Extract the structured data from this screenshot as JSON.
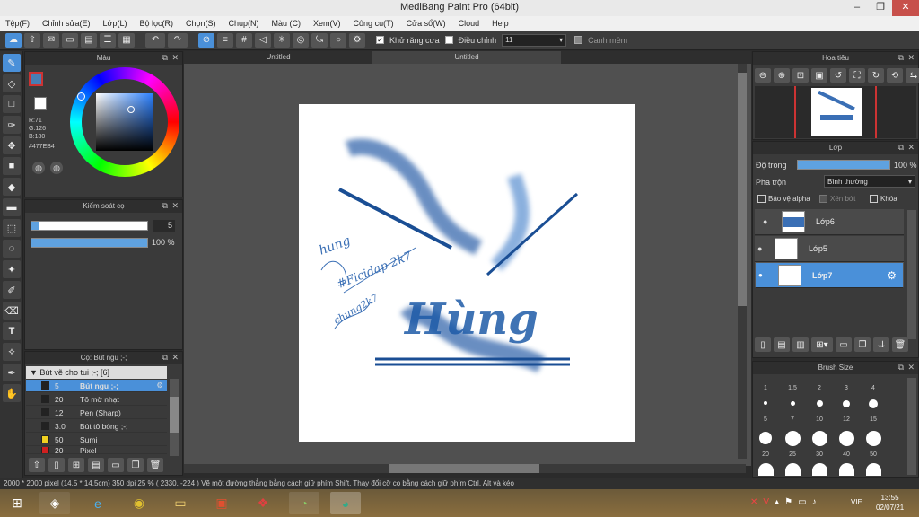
{
  "window": {
    "title": "MediBang Paint Pro (64bit)",
    "minimize": "–",
    "restore": "❐",
    "close": "✕"
  },
  "menu": [
    "Tệp(F)",
    "Chỉnh sửa(E)",
    "Lớp(L)",
    "Bộ lọc(R)",
    "Chọn(S)",
    "Chụp(N)",
    "Màu (C)",
    "Xem(V)",
    "Công cụ(T)",
    "Cửa sổ(W)",
    "Cloud",
    "Help"
  ],
  "toolbar": {
    "antialias_label": "Khử răng cưa",
    "correction_label": "Điều chỉnh",
    "correction_value": "11",
    "snap_label": "Canh mềm"
  },
  "tabs": [
    "Untitled",
    "Untitled"
  ],
  "color_panel": {
    "title": "Màu",
    "r": "R:71",
    "g": "G:126",
    "b": "B:180",
    "hex": "#477EB4",
    "primary_color": "#477EB4"
  },
  "brush_control": {
    "title": "Kiểm soát cọ",
    "size": "5",
    "opacity": "100 %"
  },
  "brush_list": {
    "title": "Cọ: Bút ngu ;-;",
    "group": "Bút vẽ cho tui ;-; [6]",
    "items": [
      {
        "size": "5",
        "name": "Bút ngu ;-;",
        "color": "#222222",
        "selected": true
      },
      {
        "size": "20",
        "name": "Tô mờ nhạt",
        "color": "#222222"
      },
      {
        "size": "12",
        "name": "Pen (Sharp)",
        "color": "#222222"
      },
      {
        "size": "3.0",
        "name": "Bút tô bóng ;-;",
        "color": "#222222"
      },
      {
        "size": "50",
        "name": "Sumi",
        "color": "#f0d020"
      },
      {
        "size": "20",
        "name": "Pixel",
        "color": "#d02020"
      }
    ]
  },
  "navigator": {
    "title": "Hoa tiêu"
  },
  "layers": {
    "title": "Lớp",
    "opacity_label": "Độ trong",
    "opacity_value": "100 %",
    "blend_label": "Pha trộn",
    "blend_value": "Bình thường",
    "protect_alpha": "Bảo vệ alpha",
    "clipping": "Xén bớt",
    "lock": "Khóa",
    "items": [
      {
        "name": "Lớp6",
        "selected": false
      },
      {
        "name": "Lớp5",
        "selected": false
      },
      {
        "name": "Lớp7",
        "selected": true
      }
    ]
  },
  "brush_size": {
    "title": "Brush Size",
    "sizes": [
      "1",
      "1.5",
      "2",
      "3",
      "4",
      "5",
      "7",
      "10",
      "12",
      "15",
      "20",
      "25",
      "30",
      "40",
      "50"
    ]
  },
  "canvas_text": {
    "main": "Hùng",
    "side": "hung",
    "side2": "#Ficidap 2k7",
    "side3": "chung2k7"
  },
  "status": "2000 * 2000 pixel   (14.5 * 14.5cm)   350 dpi   25 %   ( 2330, -224 )   Vẽ một đường thẳng bằng cách giữ phím Shift, Thay đổi cỡ cọ bằng cách giữ phím Ctrl, Alt và kéo",
  "clock": {
    "time": "13:55",
    "date": "02/07/21",
    "lang": "VIE"
  }
}
